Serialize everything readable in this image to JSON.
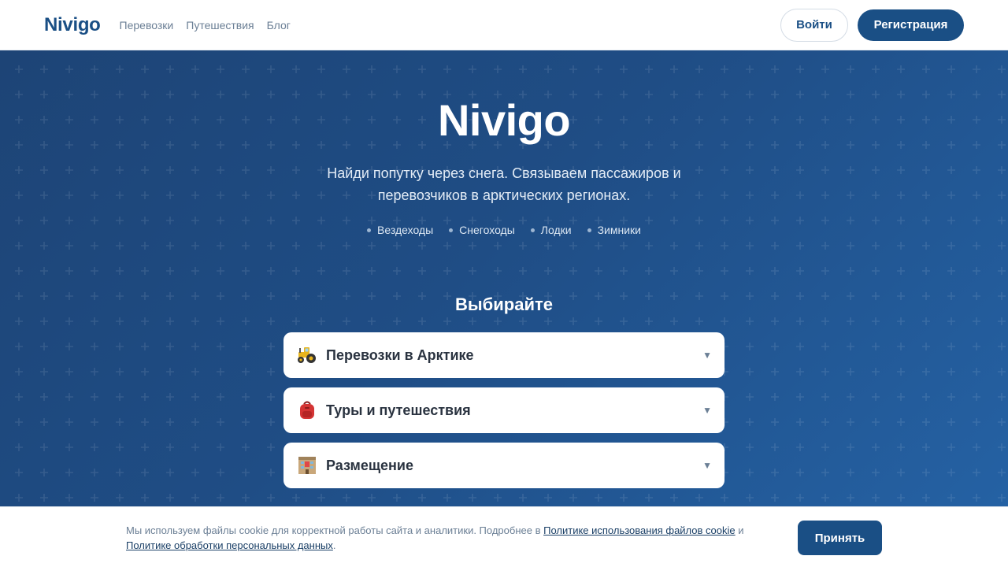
{
  "header": {
    "logo": "Nivigo",
    "nav": [
      "Перевозки",
      "Путешествия",
      "Блог"
    ],
    "login_label": "Войти",
    "register_label": "Регистрация"
  },
  "hero": {
    "title": "Nivigo",
    "subtitle": "Найди попутку через снега. Связываем пассажиров и перевозчиков в арктических регионах.",
    "tags": [
      "Вездеходы",
      "Снегоходы",
      "Лодки",
      "Зимники"
    ],
    "choose_title": "Выбирайте",
    "sections": [
      {
        "label": "Перевозки в Арктике",
        "icon": "tractor-icon"
      },
      {
        "label": "Туры и путешествия",
        "icon": "backpack-icon"
      },
      {
        "label": "Размещение",
        "icon": "hotel-icon"
      }
    ]
  },
  "cookie": {
    "text_before": "Мы используем файлы cookie для корректной работы сайта и аналитики. Подробнее в ",
    "link_cookie": "Политике использования файлов cookie",
    "text_and": " и ",
    "link_privacy": "Политике обработки персональных данных",
    "text_end": ".",
    "accept_label": "Принять"
  },
  "colors": {
    "brand": "#1a4f85",
    "hero_gradient_start": "#1d4476",
    "hero_gradient_end": "#2563a6"
  }
}
